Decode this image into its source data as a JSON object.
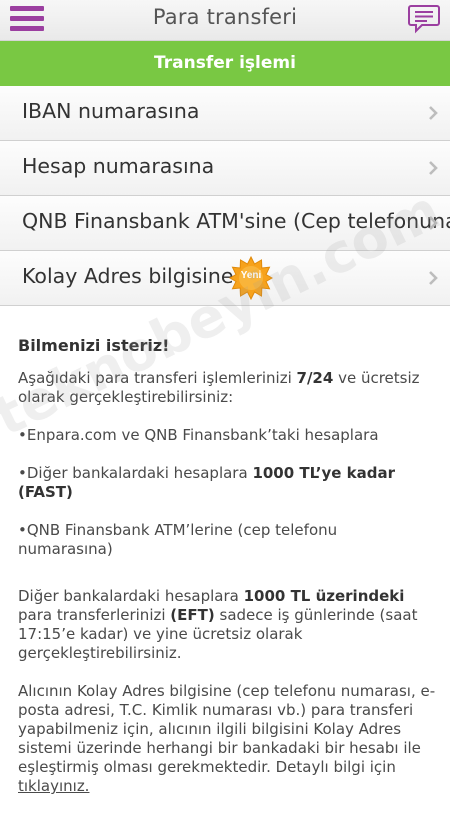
{
  "header": {
    "title": "Para transferi",
    "menu_icon": "hamburger-menu-icon",
    "chat_icon": "chat-bubble-icon",
    "accent_color": "#9b3fa0"
  },
  "section": {
    "title": "Transfer işlemi",
    "color": "#79c843"
  },
  "menu_items": [
    {
      "label": "IBAN numarasına"
    },
    {
      "label": "Hesap numarasına"
    },
    {
      "label": "QNB Finansbank ATM'sine (Cep telefonuna)"
    },
    {
      "label": "Kolay Adres bilgisine",
      "badge": "Yeni"
    }
  ],
  "info": {
    "heading": "Bilmenizi isteriz!",
    "intro_pre": "Aşağıdaki para transferi işlemlerinizi ",
    "intro_bold": "7/24",
    "intro_post": " ve ücretsiz olarak gerçekleştirebilirsiniz:",
    "bullet1": "•Enpara.com ve QNB Finansbank’taki hesaplara",
    "bullet2_pre": "•Diğer bankalardaki hesaplara ",
    "bullet2_bold": "1000 TL’ye kadar (FAST)",
    "bullet3": "•QNB Finansbank ATM’lerine (cep telefonu numarasına)",
    "para2_pre": "Diğer bankalardaki hesaplara ",
    "para2_bold1": "1000 TL üzerindeki",
    "para2_mid": " para transferlerinizi ",
    "para2_bold2": "(EFT)",
    "para2_post": " sadece iş günlerinde (saat 17:15’e kadar) ve yine ücretsiz olarak gerçekleştirebilirsiniz.",
    "para3": "Alıcının Kolay Adres bilgisine (cep telefonu numarası, e-posta adresi, T.C. Kimlik numarası vb.) para transferi yapabilmeniz için, alıcının ilgili bilgisini Kolay Adres sistemi üzerinde herhangi bir bankadaki bir hesabı ile eşleştirmiş olması gerekmektedir. Detaylı bilgi için ",
    "link": "tıklayınız."
  },
  "watermark": "teknobeyin.com"
}
